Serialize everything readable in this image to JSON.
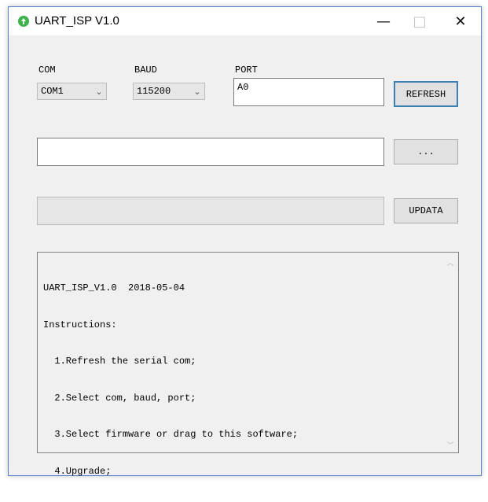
{
  "window": {
    "title": "UART_ISP V1.0",
    "minimize_glyph": "—",
    "maximize_glyph": "□",
    "close_glyph": "✕"
  },
  "com": {
    "label": "COM",
    "value": "COM1"
  },
  "baud": {
    "label": "BAUD",
    "value": "115200"
  },
  "port": {
    "label": "PORT",
    "value": "A0"
  },
  "buttons": {
    "refresh": "REFRESH",
    "browse": "...",
    "update": "UPDATA"
  },
  "file_path": {
    "value": ""
  },
  "progress": {
    "value": 0
  },
  "log": {
    "lines": [
      "UART_ISP_V1.0  2018-05-04",
      "Instructions:",
      "  1.Refresh the serial com;",
      "  2.Select com, baud, port;",
      "  3.Select firmware or drag to this software;",
      "  4.Upgrade;"
    ]
  },
  "icons": {
    "app": "app-icon",
    "chevron": "chevron-down-icon",
    "scroll_up": "scroll-up-icon",
    "scroll_down": "scroll-down-icon"
  },
  "colors": {
    "accent": "#3c7fb1",
    "app_icon": "#3fb24a",
    "window_border": "#5a82c8"
  }
}
